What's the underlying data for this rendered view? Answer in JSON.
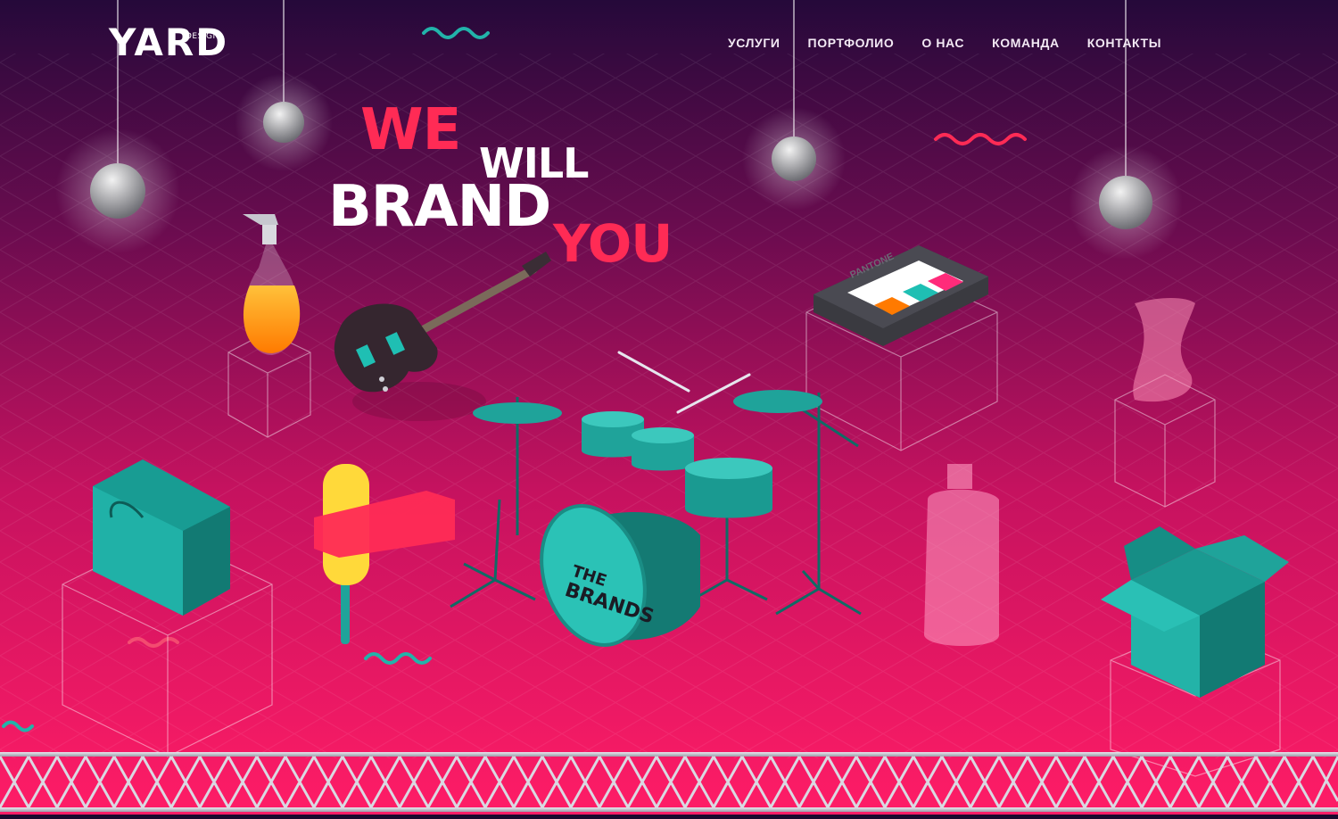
{
  "header": {
    "logo_text": "YARD",
    "logo_sub": "DESIGN"
  },
  "nav": {
    "items": [
      "УСЛУГИ",
      "ПОРТФОЛИО",
      "О НАС",
      "КОМАНДА",
      "КОНТАКТЫ"
    ]
  },
  "hero": {
    "line1": "WE",
    "line2": "WILL",
    "line3": "BRAND",
    "line4": "YOU"
  },
  "scene": {
    "drum_text_1": "THE",
    "drum_text_2": "BRANDS",
    "palette_label": "PANTONE"
  },
  "colors": {
    "bg_top": "#2a0b3d",
    "bg_bottom": "#ff1c6b",
    "accent_red": "#ff2b55",
    "teal": "#1fa39a",
    "teal_dark": "#147a73"
  }
}
